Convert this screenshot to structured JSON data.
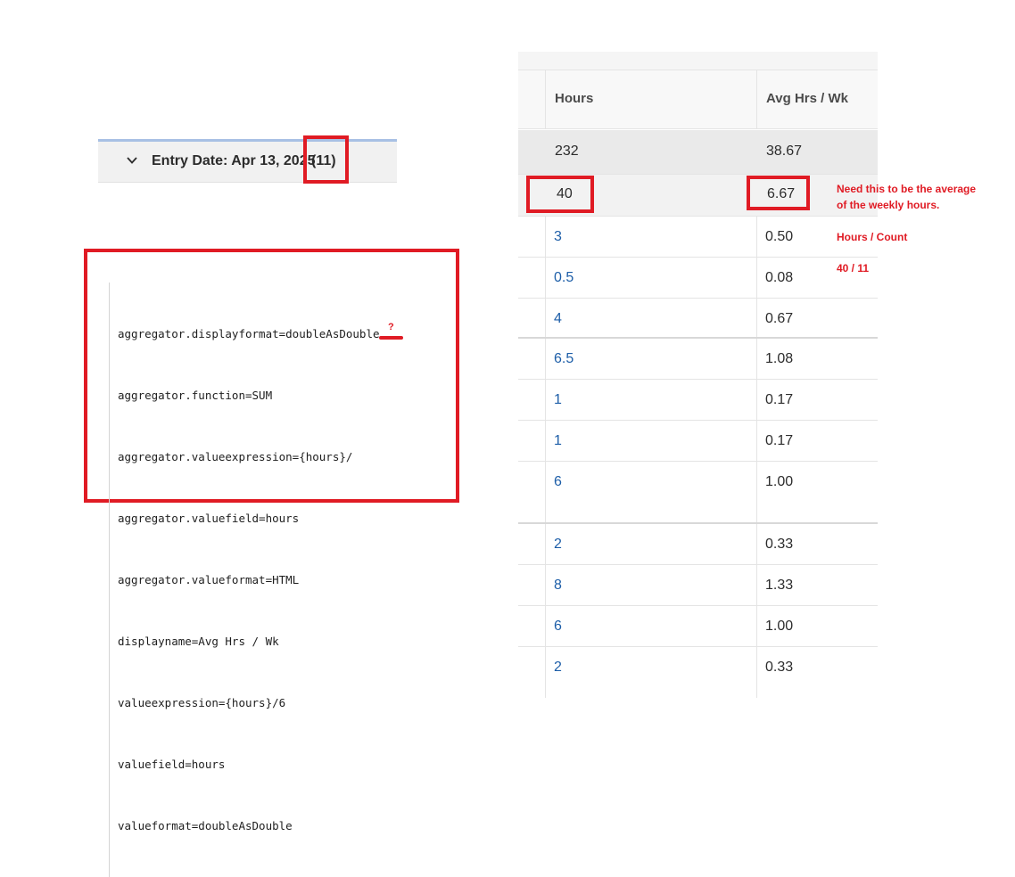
{
  "group_header": {
    "title": "Entry Date: Apr 13, 2025",
    "count": "(11)"
  },
  "code": {
    "lines": [
      "aggregator.displayformat=doubleAsDouble",
      "aggregator.function=SUM",
      "aggregator.valueexpression={hours}/",
      "aggregator.valuefield=hours",
      "aggregator.valueformat=HTML",
      "displayname=Avg Hrs / Wk",
      "valueexpression={hours}/6",
      "valuefield=hours",
      "valueformat=doubleAsDouble"
    ],
    "question_mark": "?"
  },
  "table": {
    "columns": [
      "Hours",
      "Avg Hrs / Wk"
    ],
    "total_row": {
      "hours": "232",
      "avg": "38.67"
    },
    "group_row": {
      "hours": "40",
      "avg": "6.67"
    },
    "rows": [
      {
        "hours": "3",
        "avg": "0.50"
      },
      {
        "hours": "0.5",
        "avg": "0.08"
      },
      {
        "hours": "4",
        "avg": "0.67"
      },
      {
        "hours": "6.5",
        "avg": "1.08"
      },
      {
        "hours": "1",
        "avg": "0.17"
      },
      {
        "hours": "1",
        "avg": "0.17"
      },
      {
        "hours": "6",
        "avg": "1.00"
      },
      {
        "hours": "2",
        "avg": "0.33"
      },
      {
        "hours": "8",
        "avg": "1.33"
      },
      {
        "hours": "6",
        "avg": "1.00"
      },
      {
        "hours": "2",
        "avg": "0.33"
      }
    ]
  },
  "annotations": {
    "note_line1": "Need this to be the average",
    "note_line2": "of the weekly hours.",
    "formula": "Hours / Count",
    "example": "40 / 11"
  },
  "colors": {
    "highlight": "#e01b24",
    "link": "#1d5ea8"
  }
}
